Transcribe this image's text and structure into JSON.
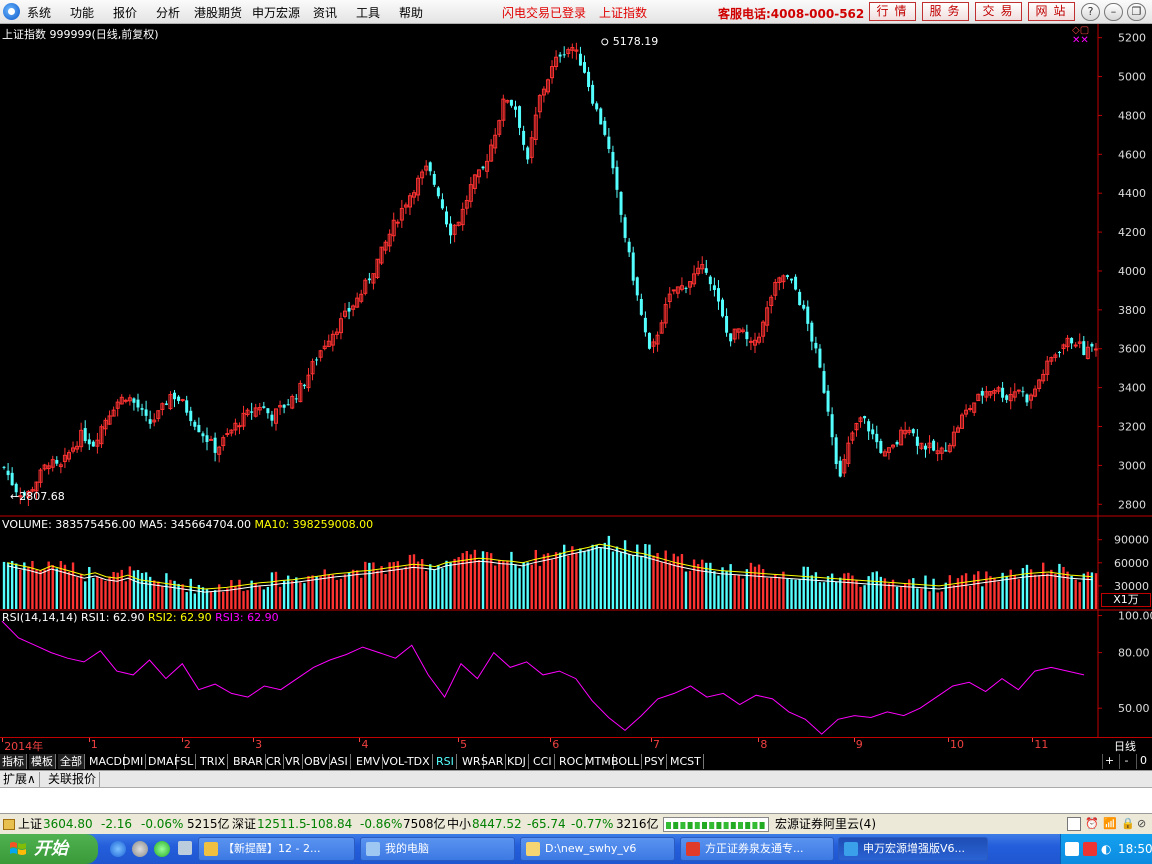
{
  "menu": {
    "items": [
      "系统",
      "功能",
      "报价",
      "分析",
      "港股期货",
      "申万宏源",
      "资讯",
      "工具",
      "帮助"
    ],
    "notice_login": "闪电交易已登录",
    "notice_index": "上证指数",
    "hotline": "客服电话:4008-000-562",
    "buttons": [
      "行情",
      "服务",
      "交易",
      "网站"
    ],
    "window_controls": [
      "?",
      "minimize-icon",
      "restore-icon",
      "close-icon"
    ]
  },
  "chart_header": {
    "title": "上证指数 999999(日线,前复权)",
    "high_label": "5178.19",
    "low_label": "2807.68"
  },
  "volume_header": {
    "vol_label": "VOLUME: 383575456.00",
    "ma5_label": "MA5: 345664704.00",
    "ma10_label": "MA10: 398259008.00",
    "unit": "X1万"
  },
  "rsi_header": {
    "name": "RSI(14,14,14)",
    "rsi1": "RSI1: 62.90",
    "rsi2": "RSI2: 62.90",
    "rsi3": "RSI3: 62.90"
  },
  "colors": {
    "up": "#ff3232",
    "down": "#54ffff",
    "ma5": "#ffffff",
    "ma10": "#ffff00",
    "rsi": "#ff00ff",
    "axis": "#c00000"
  },
  "chart_data": {
    "type": "candlestick",
    "price_axis": {
      "ticks": [
        2800,
        3000,
        3200,
        3400,
        3600,
        3800,
        4000,
        4200,
        4400,
        4600,
        4800,
        5000,
        5200
      ],
      "range": [
        2750,
        5260
      ]
    },
    "volume_axis": {
      "ticks": [
        30000,
        60000,
        90000
      ],
      "range": [
        0,
        100000
      ],
      "unit": "万"
    },
    "rsi_axis": {
      "ticks": [
        50,
        80,
        100
      ],
      "range": [
        35,
        103
      ]
    },
    "month_labels": [
      "2014年",
      "1",
      "2",
      "3",
      "4",
      "5",
      "6",
      "7",
      "8",
      "9",
      "10",
      "11"
    ],
    "period_label": "日线",
    "close_path": [
      [
        0,
        2990
      ],
      [
        2,
        2880
      ],
      [
        4,
        2840
      ],
      [
        6,
        2930
      ],
      [
        8,
        3020
      ],
      [
        10,
        2980
      ],
      [
        12,
        3080
      ],
      [
        14,
        3160
      ],
      [
        16,
        3110
      ],
      [
        18,
        3230
      ],
      [
        20,
        3320
      ],
      [
        22,
        3360
      ],
      [
        24,
        3300
      ],
      [
        26,
        3210
      ],
      [
        28,
        3270
      ],
      [
        30,
        3370
      ],
      [
        32,
        3320
      ],
      [
        34,
        3230
      ],
      [
        36,
        3150
      ],
      [
        38,
        3080
      ],
      [
        40,
        3150
      ],
      [
        42,
        3220
      ],
      [
        44,
        3270
      ],
      [
        46,
        3310
      ],
      [
        48,
        3250
      ],
      [
        50,
        3300
      ],
      [
        52,
        3350
      ],
      [
        54,
        3430
      ],
      [
        56,
        3550
      ],
      [
        58,
        3650
      ],
      [
        60,
        3720
      ],
      [
        62,
        3800
      ],
      [
        64,
        3880
      ],
      [
        66,
        3990
      ],
      [
        68,
        4110
      ],
      [
        70,
        4240
      ],
      [
        72,
        4350
      ],
      [
        74,
        4450
      ],
      [
        76,
        4530
      ],
      [
        78,
        4400
      ],
      [
        80,
        4200
      ],
      [
        82,
        4280
      ],
      [
        84,
        4450
      ],
      [
        86,
        4520
      ],
      [
        88,
        4700
      ],
      [
        90,
        4900
      ],
      [
        92,
        4830
      ],
      [
        94,
        4550
      ],
      [
        96,
        4880
      ],
      [
        98,
        5020
      ],
      [
        100,
        5130
      ],
      [
        102,
        5150
      ],
      [
        104,
        5050
      ],
      [
        106,
        4850
      ],
      [
        108,
        4700
      ],
      [
        110,
        4400
      ],
      [
        112,
        4100
      ],
      [
        114,
        3820
      ],
      [
        116,
        3560
      ],
      [
        118,
        3750
      ],
      [
        120,
        3900
      ],
      [
        122,
        3920
      ],
      [
        124,
        3980
      ],
      [
        126,
        4020
      ],
      [
        128,
        3850
      ],
      [
        130,
        3650
      ],
      [
        132,
        3700
      ],
      [
        134,
        3610
      ],
      [
        136,
        3700
      ],
      [
        138,
        3900
      ],
      [
        140,
        3980
      ],
      [
        142,
        3910
      ],
      [
        144,
        3750
      ],
      [
        146,
        3550
      ],
      [
        148,
        3280
      ],
      [
        150,
        2920
      ],
      [
        152,
        3150
      ],
      [
        154,
        3250
      ],
      [
        156,
        3150
      ],
      [
        158,
        3050
      ],
      [
        160,
        3100
      ],
      [
        162,
        3220
      ],
      [
        164,
        3120
      ],
      [
        166,
        3090
      ],
      [
        168,
        3060
      ],
      [
        170,
        3130
      ],
      [
        172,
        3250
      ],
      [
        174,
        3320
      ],
      [
        176,
        3380
      ],
      [
        178,
        3400
      ],
      [
        180,
        3350
      ],
      [
        182,
        3400
      ],
      [
        184,
        3330
      ],
      [
        186,
        3450
      ],
      [
        188,
        3550
      ],
      [
        190,
        3620
      ],
      [
        192,
        3650
      ],
      [
        194,
        3580
      ],
      [
        196,
        3620
      ]
    ],
    "rsi_path": [
      [
        0,
        97
      ],
      [
        3,
        88
      ],
      [
        6,
        84
      ],
      [
        9,
        80
      ],
      [
        12,
        77
      ],
      [
        15,
        75
      ],
      [
        18,
        81
      ],
      [
        21,
        70
      ],
      [
        24,
        68
      ],
      [
        27,
        76
      ],
      [
        30,
        66
      ],
      [
        33,
        74
      ],
      [
        36,
        60
      ],
      [
        39,
        63
      ],
      [
        42,
        58
      ],
      [
        45,
        56
      ],
      [
        48,
        62
      ],
      [
        51,
        60
      ],
      [
        54,
        66
      ],
      [
        57,
        72
      ],
      [
        60,
        76
      ],
      [
        63,
        79
      ],
      [
        66,
        83
      ],
      [
        69,
        80
      ],
      [
        72,
        77
      ],
      [
        75,
        84
      ],
      [
        78,
        68
      ],
      [
        81,
        56
      ],
      [
        84,
        74
      ],
      [
        87,
        66
      ],
      [
        90,
        80
      ],
      [
        93,
        72
      ],
      [
        96,
        75
      ],
      [
        99,
        68
      ],
      [
        102,
        70
      ],
      [
        105,
        66
      ],
      [
        108,
        54
      ],
      [
        111,
        45
      ],
      [
        114,
        38
      ],
      [
        117,
        46
      ],
      [
        120,
        55
      ],
      [
        123,
        58
      ],
      [
        126,
        62
      ],
      [
        129,
        56
      ],
      [
        132,
        58
      ],
      [
        135,
        52
      ],
      [
        138,
        57
      ],
      [
        141,
        55
      ],
      [
        144,
        48
      ],
      [
        147,
        44
      ],
      [
        150,
        36
      ],
      [
        153,
        44
      ],
      [
        156,
        46
      ],
      [
        159,
        45
      ],
      [
        162,
        48
      ],
      [
        165,
        46
      ],
      [
        168,
        50
      ],
      [
        171,
        56
      ],
      [
        174,
        62
      ],
      [
        177,
        64
      ],
      [
        180,
        59
      ],
      [
        183,
        66
      ],
      [
        186,
        60
      ],
      [
        189,
        70
      ],
      [
        192,
        72
      ],
      [
        195,
        70
      ],
      [
        198,
        68
      ]
    ],
    "volume_levels": [
      58,
      55,
      52,
      48,
      54,
      50,
      46,
      42,
      45,
      40,
      38,
      42,
      36,
      34,
      32,
      30,
      28,
      26,
      24,
      25,
      26,
      28,
      30,
      32,
      33,
      35,
      36,
      38,
      40,
      42,
      44,
      45,
      47,
      48,
      50,
      52,
      54,
      56,
      55,
      53,
      58,
      60,
      62,
      64,
      63,
      61,
      60,
      58,
      62,
      65,
      68,
      72,
      75,
      78,
      82,
      80,
      76,
      72,
      70,
      66,
      62,
      58,
      55,
      52,
      50,
      48,
      47,
      46,
      45,
      44,
      43,
      42,
      41,
      40,
      39,
      38,
      37,
      36,
      35,
      34,
      33,
      32,
      31,
      30,
      29,
      28,
      30,
      32,
      34,
      36,
      38,
      40,
      42,
      44,
      45,
      46,
      44,
      42,
      41,
      40
    ]
  },
  "tabs": {
    "groups": [
      "指标",
      "模板",
      "全部"
    ],
    "indicators": [
      "MACD",
      "DMI",
      "DMA",
      "FSL",
      "TRIX",
      "BRAR",
      "CR",
      "VR",
      "OBV",
      "ASI",
      "EMV",
      "VOL-TDX",
      "RSI",
      "WR",
      "SAR",
      "KDJ",
      "CCI",
      "ROC",
      "MTM",
      "BOLL",
      "PSY",
      "MCST"
    ],
    "active": "RSI",
    "controls": [
      "+",
      "-",
      "0"
    ]
  },
  "subtabs": [
    "扩展∧",
    "关联报价"
  ],
  "status": {
    "sh_label": "上证",
    "sh_value": "3604.80",
    "sh_change": "-2.16",
    "sh_pct": "-0.06%",
    "sh_amount": "5215亿",
    "sz_label": "深证",
    "sz_value": "12511.5",
    "sz_change": "-108.84",
    "sz_pct": "-0.86%",
    "sz_amount": "7508亿",
    "zx_label": "中小",
    "zx_value": "8447.52",
    "zx_change": "-65.74",
    "zx_pct": "-0.77%",
    "zx_amount": "3216亿",
    "server": "宏源证券阿里云(4)"
  },
  "taskbar": {
    "start": "开始",
    "tasks": [
      {
        "label": "【新提醒】12 - 2...",
        "icon_color": "#f0c040"
      },
      {
        "label": "我的电脑",
        "icon_color": "#9ec8f2"
      },
      {
        "label": "D:\\new_swhy_v6",
        "icon_color": "#f5d572"
      },
      {
        "label": "方正证券泉友通专...",
        "icon_color": "#e03a2a"
      },
      {
        "label": "申万宏源增强版V6...",
        "icon_color": "#3aa0ea"
      }
    ],
    "clock": "18:50"
  }
}
